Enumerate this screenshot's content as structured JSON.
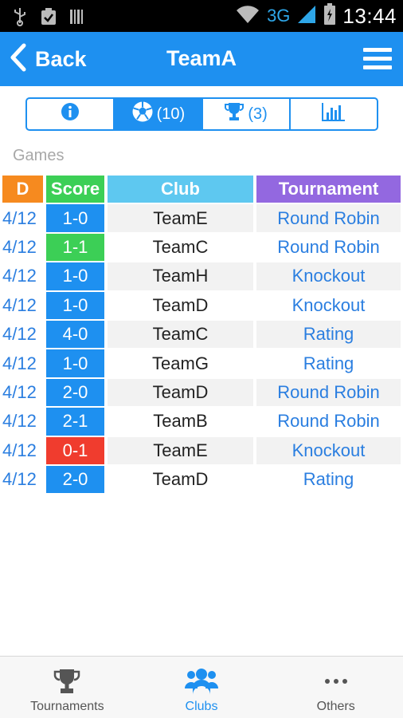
{
  "status_bar": {
    "network": "3G",
    "time": "13:44"
  },
  "header": {
    "back_label": "Back",
    "title": "TeamA"
  },
  "segments": [
    {
      "icon": "info-icon",
      "count": ""
    },
    {
      "icon": "soccer-ball-icon",
      "count": "(10)"
    },
    {
      "icon": "trophy-icon",
      "count": "(3)"
    },
    {
      "icon": "bar-chart-icon",
      "count": ""
    }
  ],
  "section_label": "Games",
  "table": {
    "headers": {
      "date": "D",
      "score": "Score",
      "club": "Club",
      "tournament": "Tournament"
    },
    "colors": {
      "win": "#1e90f0",
      "draw": "#3ccf56",
      "loss": "#f03c2e"
    },
    "rows": [
      {
        "date": "4/12",
        "score": "1-0",
        "result": "win",
        "club": "TeamE",
        "tournament": "Round Robin"
      },
      {
        "date": "4/12",
        "score": "1-1",
        "result": "draw",
        "club": "TeamC",
        "tournament": "Round Robin"
      },
      {
        "date": "4/12",
        "score": "1-0",
        "result": "win",
        "club": "TeamH",
        "tournament": "Knockout"
      },
      {
        "date": "4/12",
        "score": "1-0",
        "result": "win",
        "club": "TeamD",
        "tournament": "Knockout"
      },
      {
        "date": "4/12",
        "score": "4-0",
        "result": "win",
        "club": "TeamC",
        "tournament": "Rating"
      },
      {
        "date": "4/12",
        "score": "1-0",
        "result": "win",
        "club": "TeamG",
        "tournament": "Rating"
      },
      {
        "date": "4/12",
        "score": "2-0",
        "result": "win",
        "club": "TeamD",
        "tournament": "Round Robin"
      },
      {
        "date": "4/12",
        "score": "2-1",
        "result": "win",
        "club": "TeamB",
        "tournament": "Round Robin"
      },
      {
        "date": "4/12",
        "score": "0-1",
        "result": "loss",
        "club": "TeamE",
        "tournament": "Knockout"
      },
      {
        "date": "4/12",
        "score": "2-0",
        "result": "win",
        "club": "TeamD",
        "tournament": "Rating"
      }
    ]
  },
  "tabs": [
    {
      "label": "Tournaments",
      "icon": "trophy-icon",
      "active": false
    },
    {
      "label": "Clubs",
      "icon": "group-icon",
      "active": true
    },
    {
      "label": "Others",
      "icon": "more-icon",
      "active": false
    }
  ],
  "accent_color": "#1e90f0"
}
